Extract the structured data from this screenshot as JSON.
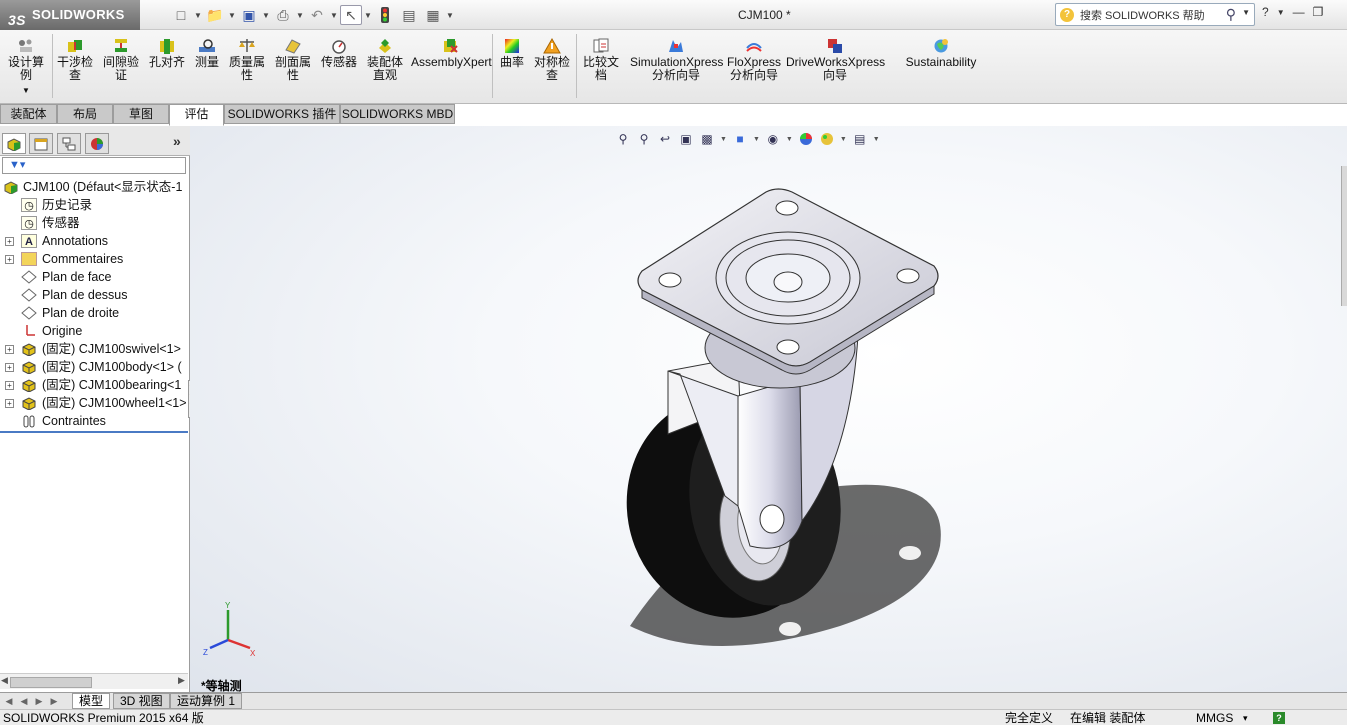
{
  "app": {
    "brand": "SOLIDWORKS",
    "document_title": "CJM100 *"
  },
  "search": {
    "placeholder": "搜索 SOLIDWORKS 帮助"
  },
  "ribbon": {
    "buttons": [
      {
        "id": "design-study",
        "label": "设计算\n例"
      },
      {
        "id": "interference",
        "label": "干涉检\n查"
      },
      {
        "id": "clearance",
        "label": "间隙验\n证"
      },
      {
        "id": "hole-align",
        "label": "孔对齐"
      },
      {
        "id": "measure",
        "label": "测量"
      },
      {
        "id": "mass-props",
        "label": "质量属\n性"
      },
      {
        "id": "section-props",
        "label": "剖面属\n性"
      },
      {
        "id": "sensor",
        "label": "传感器"
      },
      {
        "id": "assembly-visual",
        "label": "装配体\n直观"
      },
      {
        "id": "assemblyxpert",
        "label": "AssemblyXpert"
      },
      {
        "id": "curvature",
        "label": "曲率"
      },
      {
        "id": "symmetry",
        "label": "对称检\n查"
      },
      {
        "id": "compare",
        "label": "比较文\n档"
      },
      {
        "id": "simulationxpress",
        "label": "SimulationXpress\n分析向导"
      },
      {
        "id": "floxpress",
        "label": "FloXpress\n分析向导"
      },
      {
        "id": "driveworks",
        "label": "DriveWorksXpress\n向导"
      },
      {
        "id": "sustainability",
        "label": "Sustainability"
      }
    ]
  },
  "tabs": [
    "装配体",
    "布局",
    "草图",
    "评估",
    "SOLIDWORKS 插件",
    "SOLIDWORKS MBD"
  ],
  "active_tab": "评估",
  "tree": {
    "root": "CJM100  (Défaut<显示状态-1",
    "items": [
      {
        "label": "历史记录",
        "icon": "history-icon"
      },
      {
        "label": "传感器",
        "icon": "sensor-icon"
      },
      {
        "label": "Annotations",
        "icon": "annotations-icon"
      },
      {
        "label": "Commentaires",
        "icon": "comments-folder-icon"
      },
      {
        "label": "Plan de face",
        "icon": "plane-icon"
      },
      {
        "label": "Plan de dessus",
        "icon": "plane-icon"
      },
      {
        "label": "Plan de droite",
        "icon": "plane-icon"
      },
      {
        "label": "Origine",
        "icon": "origin-icon"
      },
      {
        "label": "(固定) CJM100swivel<1>",
        "icon": "part-icon"
      },
      {
        "label": "(固定) CJM100body<1> (",
        "icon": "part-icon"
      },
      {
        "label": "(固定) CJM100bearing<1",
        "icon": "part-icon"
      },
      {
        "label": "(固定) CJM100wheel1<1>",
        "icon": "part-icon"
      },
      {
        "label": "Contraintes",
        "icon": "mates-icon"
      }
    ]
  },
  "viewport": {
    "view_label": "*等轴测",
    "triad": {
      "x": "X",
      "y": "Y",
      "z": "Z"
    }
  },
  "bottom_tabs": [
    "模型",
    "3D 视图",
    "运动算例 1"
  ],
  "active_bottom_tab": "模型",
  "status": {
    "product": "SOLIDWORKS Premium 2015 x64 版",
    "definition": "完全定义",
    "mode": "在编辑 装配体",
    "units": "MMGS",
    "units_arrow": "▾",
    "help": "?"
  },
  "colors": {
    "accent": "#2a62c9",
    "tab_bg": "#c9c9c9",
    "wheel": "#111111",
    "bracket": "#e8e8ee"
  }
}
